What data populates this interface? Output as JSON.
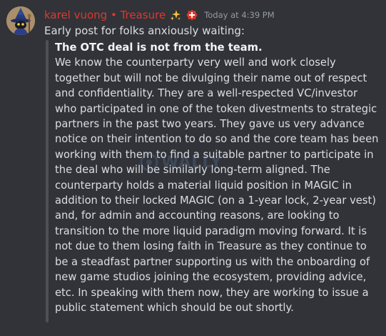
{
  "message": {
    "author": "karel vuong • Treasure",
    "timestamp": "Today at 4:39 PM",
    "intro": "Early post for folks anxiously waiting:",
    "quote_heading": "The OTC deal is not from the team.",
    "quote_lines": [
      "We know the counterparty very well and work closely",
      "together but will not be divulging their name out of respect",
      "and confidentiality. They are a well-respected VC/investor",
      "who participated in one of the token divestments to strategic",
      "partners in the past two years. They gave us very advance",
      "notice on their intention to do so and the core team has been",
      "working with them to find a suitable partner to participate in",
      "the deal who will be similarly long-term aligned. The",
      "counterparty holds a material liquid position in MAGIC in",
      "addition to their locked MAGIC (on a 1-year lock, 2-year vest)",
      "and, for admin and accounting reasons, are looking to",
      "transition to the more liquid paradigm moving forward. It is",
      "not due to them losing faith in Treasure as they continue to",
      "be a steadfast partner supporting us with the onboarding of",
      "new game studios joining the ecosystem, providing advice,",
      "etc. In speaking with them now, they are working to issue a",
      "public statement which should be out shortly."
    ],
    "watermark": "WALLY"
  },
  "icons": {
    "avatar": "wizard-avatar-icon",
    "sparkle": "sparkles-icon",
    "role": "role-badge-icon"
  },
  "colors": {
    "background": "#313338",
    "username": "#e2362c",
    "text": "#dbdee1",
    "timestamp": "#949ba4",
    "quote_bar": "#4e5058"
  }
}
